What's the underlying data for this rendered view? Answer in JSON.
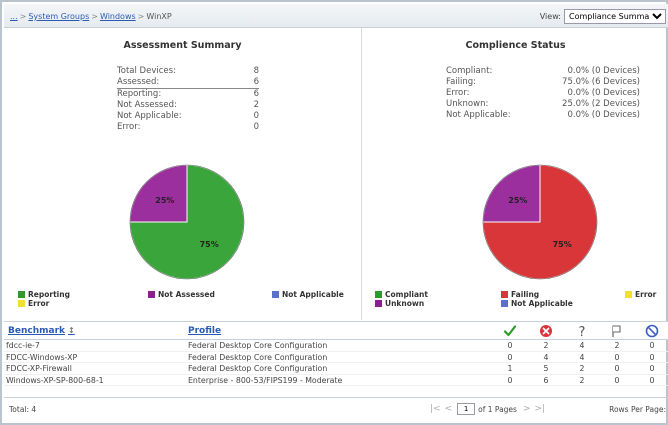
{
  "breadcrumb": {
    "ellipsis": "...",
    "sep": ">",
    "items": [
      "System Groups",
      "Windows"
    ],
    "current": "WinXP"
  },
  "view": {
    "label": "View:",
    "selected": "Compliance Summary"
  },
  "assessment": {
    "title": "Assessment Summary",
    "rows": [
      {
        "label": "Total Devices:",
        "value": "8"
      },
      {
        "label": "Assessed:",
        "value": "6"
      },
      {
        "label": "Reporting:",
        "value": "6"
      },
      {
        "label": "Not Assessed:",
        "value": "2"
      },
      {
        "label": "Not Applicable:",
        "value": "0"
      },
      {
        "label": "Error:",
        "value": "0"
      }
    ],
    "pie": {
      "slices": [
        {
          "label": "75%",
          "value": 75,
          "color": "#3aa53a"
        },
        {
          "label": "25%",
          "value": 25,
          "color": "#9b2f9e"
        }
      ]
    },
    "legend": [
      {
        "label": "Reporting",
        "color": "#2e9a2e"
      },
      {
        "label": "Not Assessed",
        "color": "#8b1f8f"
      },
      {
        "label": "Not Applicable",
        "color": "#5b70c9"
      },
      {
        "label": "Error",
        "color": "#f1e030"
      }
    ]
  },
  "compliance": {
    "title": "Complience Status",
    "rows": [
      {
        "label": "Compliant:",
        "value": "0.0% (0 Devices)"
      },
      {
        "label": "Failing:",
        "value": "75.0% (6 Devices)"
      },
      {
        "label": "Error:",
        "value": "0.0% (0 Devices)"
      },
      {
        "label": "Unknown:",
        "value": "25.0% (2 Devices)"
      },
      {
        "label": "Not Applicable:",
        "value": "0.0% (0 Devices)"
      }
    ],
    "pie": {
      "slices": [
        {
          "label": "75%",
          "value": 75,
          "color": "#d9363a"
        },
        {
          "label": "25%",
          "value": 25,
          "color": "#9b2f9e"
        }
      ]
    },
    "legend": [
      {
        "label": "Compliant",
        "color": "#2e9a2e"
      },
      {
        "label": "Unknown",
        "color": "#8b1f8f"
      },
      {
        "label": "Failing",
        "color": "#d9363a"
      },
      {
        "label": "Not Applicable",
        "color": "#5b70c9"
      },
      {
        "label": "Error",
        "color": "#f1e030"
      }
    ]
  },
  "table": {
    "headers": {
      "benchmark": "Benchmark",
      "sort": "↕",
      "profile": "Profile"
    },
    "status_icons": [
      "check-icon",
      "fail-icon",
      "question-icon",
      "flag-icon",
      "not-applicable-icon"
    ],
    "rows": [
      {
        "benchmark": "fdcc-ie-7",
        "profile": "Federal Desktop Core Configuration",
        "counts": [
          "0",
          "2",
          "4",
          "2",
          "0"
        ]
      },
      {
        "benchmark": "FDCC-Windows-XP",
        "profile": "Federal Desktop Core Configuration",
        "counts": [
          "0",
          "4",
          "4",
          "0",
          "0"
        ]
      },
      {
        "benchmark": "FDCC-XP-Firewall",
        "profile": "Federal Desktop Core Configuration",
        "counts": [
          "1",
          "5",
          "2",
          "0",
          "0"
        ]
      },
      {
        "benchmark": "Windows-XP-SP-800-68-1",
        "profile": "Enterprise - 800-53/FIPS199 - Moderate",
        "counts": [
          "0",
          "6",
          "2",
          "0",
          "0"
        ]
      }
    ],
    "footer": {
      "total": "Total: 4",
      "page": "1",
      "of_pages": "of 1 Pages",
      "rows_per_page": "Rows Per Page:"
    }
  }
}
